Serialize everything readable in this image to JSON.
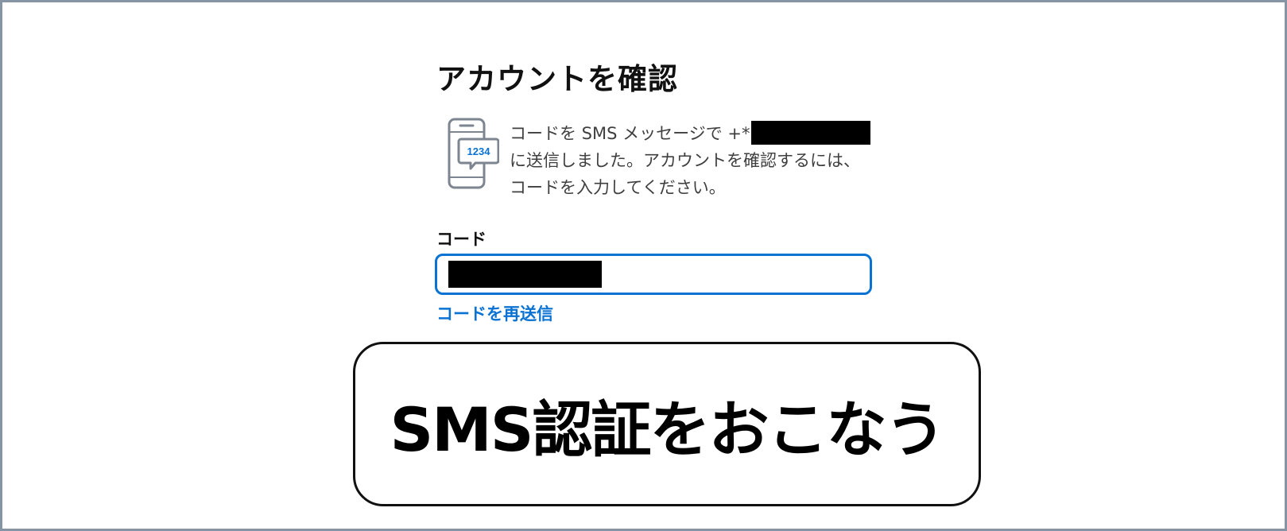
{
  "page": {
    "title": "アカウントを確認"
  },
  "info": {
    "icon": "phone-sms-code-icon",
    "icon_code": "1234",
    "line1": "コードを SMS メッセージで +*",
    "line2": "に送信しました。アカウントを確認するには、",
    "line3": "コードを入力してください。"
  },
  "form": {
    "code_label": "コード",
    "code_value": "",
    "resend_label": "コードを再送信"
  },
  "caption": {
    "text": "SMS認証をおこなう"
  },
  "colors": {
    "accent": "#0972d3",
    "frame": "#8794a4",
    "icon": "#7d8590",
    "text": "#111111"
  }
}
